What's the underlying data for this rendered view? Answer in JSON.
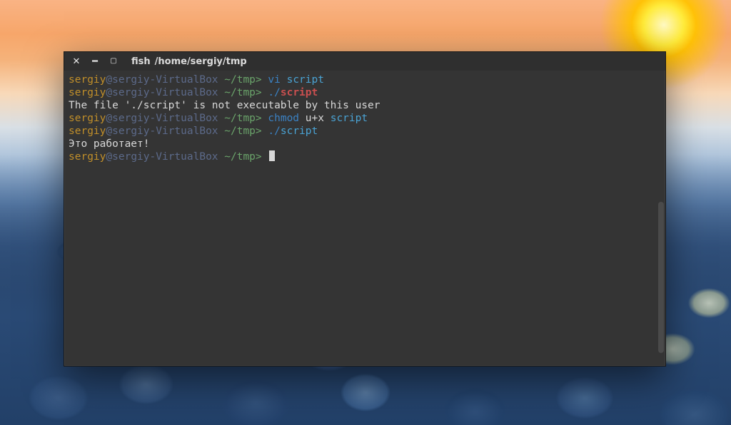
{
  "window": {
    "title_app": "fish",
    "title_path": "/home/sergiy/tmp"
  },
  "prompt": {
    "user": "sergiy",
    "at": "@",
    "host": "sergiy-VirtualBox",
    "sep_host_path": " ",
    "path": "~/tmp",
    "symbol": ">"
  },
  "lines": [
    {
      "type": "cmd",
      "cmd": "vi",
      "args": [
        {
          "t": "script",
          "cls": "c-arg"
        }
      ]
    },
    {
      "type": "cmd",
      "cmd": "./",
      "cmd_cls": "c-cmd",
      "tail": "script",
      "tail_cls": "c-invalid"
    },
    {
      "type": "out",
      "text": "The file './script' is not executable by this user"
    },
    {
      "type": "cmd",
      "cmd": "chmod",
      "args": [
        {
          "t": "u+x",
          "cls": "c-argw"
        },
        {
          "t": "script",
          "cls": "c-arg"
        }
      ]
    },
    {
      "type": "cmd",
      "cmd": "./",
      "cmd_cls": "c-cmd",
      "tail": "script",
      "tail_cls": "c-valid"
    },
    {
      "type": "out",
      "text": "Это работает!"
    },
    {
      "type": "cursor"
    }
  ],
  "colors": {
    "user": "#c18f2a",
    "host": "#5c6a8a",
    "path": "#6aa36a",
    "cmd": "#3b82c4",
    "arg": "#4aa3d4",
    "invalid": "#c94f4f",
    "output": "#d8d8d8",
    "bg": "#343434"
  }
}
